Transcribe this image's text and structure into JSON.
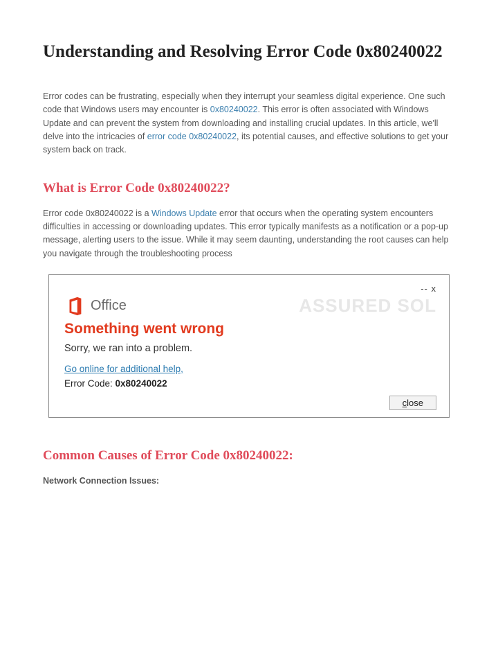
{
  "title": "Understanding and Resolving Error Code 0x80240022",
  "intro": {
    "part1": "Error codes can be frustrating, especially when they interrupt your seamless digital experience. One such code that Windows users may encounter is ",
    "link1": "0x80240022",
    "part2": ". This error is often associated with Windows Update and can prevent the system from downloading and installing crucial updates. In this article, we'll delve into the intricacies of ",
    "link2": "error code 0x80240022",
    "part3": ", its potential causes, and effective solutions to get your system back on track."
  },
  "section1": {
    "heading": "What is Error Code 0x80240022?",
    "p_part1": "Error code 0x80240022 is a ",
    "p_link": "Windows Update",
    "p_part2": " error that occurs when the operating system encounters difficulties in accessing or downloading updates. This error typically manifests as a notification or a pop-up message, alerting users to the issue. While it may seem daunting, understanding the root causes can help you navigate through the troubleshooting process"
  },
  "dialog": {
    "topright": "-- x",
    "office_label": "Office",
    "watermark": "ASSURED SOL",
    "headline": "Something went wrong",
    "sorry": "Sorry, we ran into a problem.",
    "help_link": "Go online for additional help,",
    "error_label": "Error Code: ",
    "error_value": "0x80240022",
    "close_c": "c",
    "close_rest": "lose"
  },
  "section2": {
    "heading": "Common Causes of Error Code 0x80240022:",
    "sub1": "Network Connection Issues:"
  }
}
